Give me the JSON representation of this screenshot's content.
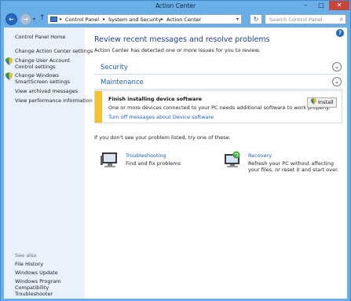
{
  "window": {
    "title": "Action Center"
  },
  "titlebar": {
    "minimize_glyph": "–",
    "maximize_glyph": "□",
    "close_glyph": "✕"
  },
  "address": {
    "back_glyph": "←",
    "forward_glyph": "→",
    "recent_glyph": "▾",
    "up_glyph": "↑",
    "crumbs": [
      "Control Panel",
      "System and Security",
      "Action Center"
    ],
    "separator": "▸",
    "dropdown_glyph": "▾",
    "refresh_glyph": "↻"
  },
  "search": {
    "placeholder": "Search Control Panel",
    "icon_glyph": "⌕"
  },
  "sidebar": {
    "items": [
      {
        "label": "Control Panel Home"
      },
      {
        "label": "Change Action Center settings"
      },
      {
        "label": "Change User Account Control settings"
      },
      {
        "label": "Change Windows SmartScreen settings"
      },
      {
        "label": "View archived messages"
      },
      {
        "label": "View performance information"
      }
    ],
    "see_also": {
      "heading": "See also",
      "items": [
        {
          "label": "File History"
        },
        {
          "label": "Windows Update"
        },
        {
          "label": "Windows Program Compatibility Troubleshooter"
        }
      ]
    }
  },
  "main": {
    "help_glyph": "?",
    "title": "Review recent messages and resolve problems",
    "subtitle": "Action Center has detected one or more issues for you to review.",
    "sections": [
      {
        "label": "Security",
        "chevron": "⌄"
      },
      {
        "label": "Maintenance",
        "chevron": "⌄"
      }
    ],
    "alert": {
      "title": "Finish installing device software",
      "description": "One or more devices connected to your PC needs additional software to work properly.",
      "link": "Turn off messages about Device software",
      "button_label": "Install"
    },
    "prompt": "If you don't see your problem listed, try one of these:",
    "tools": [
      {
        "title": "Troubleshooting",
        "description": [
          "Find and fix problems"
        ]
      },
      {
        "title": "Recovery",
        "description": [
          "Refresh your PC without affecting",
          "your files, or reset it and start over."
        ]
      }
    ]
  },
  "colors": {
    "frame": "#6aaee8",
    "sidebar_bg": "#eaf1fb",
    "title_text": "#1b3d8f",
    "link": "#1a5fc7",
    "alert_stripe": "#f6c22c",
    "close_button": "#c9433a"
  }
}
